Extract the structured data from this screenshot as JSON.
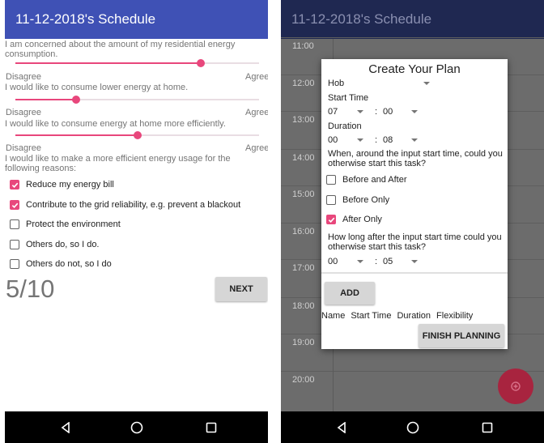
{
  "left": {
    "app_title": "11-12-2018's Schedule",
    "questions": [
      {
        "text": "I am concerned about the amount of my residential energy consumption.",
        "value": 0.76
      },
      {
        "text": "I would like to consume lower energy at home.",
        "value": 0.25
      },
      {
        "text": "I would like to consume energy at home more efficiently.",
        "value": 0.5
      }
    ],
    "scale_min_label": "Disagree",
    "scale_max_label": "Agree",
    "reasons_question": "I would like to make a more efficient energy usage for the following reasons:",
    "reasons": [
      {
        "label": "Reduce my energy bill",
        "checked": true
      },
      {
        "label": "Contribute to the grid reliability, e.g. prevent a blackout",
        "checked": true
      },
      {
        "label": "Protect the environment",
        "checked": false
      },
      {
        "label": "Others do, so I do.",
        "checked": false
      },
      {
        "label": "Others do not, so I do",
        "checked": false
      }
    ],
    "progress": "5/10",
    "next_label": "NEXT"
  },
  "right": {
    "app_title": "11-12-2018's Schedule",
    "hours": [
      "11:00",
      "12:00",
      "13:00",
      "14:00",
      "15:00",
      "16:00",
      "17:00",
      "18:00",
      "19:00",
      "20:00"
    ],
    "dialog": {
      "title": "Create Your Plan",
      "task_value": "Hob",
      "start_time_label": "Start Time",
      "start_hour": "07",
      "start_minute": "00",
      "duration_label": "Duration",
      "duration_hour": "00",
      "duration_minute": "08",
      "time_separator": ":",
      "flex_question": "When, around the input start time, could you otherwise start this task?",
      "options": [
        {
          "label": "Before and After",
          "checked": false
        },
        {
          "label": "Before Only",
          "checked": false
        },
        {
          "label": "After Only",
          "checked": true
        }
      ],
      "after_question": "How long after the input start time could you otherwise start this task?",
      "after_hour": "00",
      "after_minute": "05",
      "add_label": "ADD",
      "table_headers": [
        "Name",
        "Start Time",
        "Duration",
        "Flexibility"
      ],
      "finish_label": "FINISH PLANNING"
    }
  },
  "colors": {
    "primary": "#3f51b5",
    "accent": "#e8477c",
    "button": "#d6d6d6"
  }
}
